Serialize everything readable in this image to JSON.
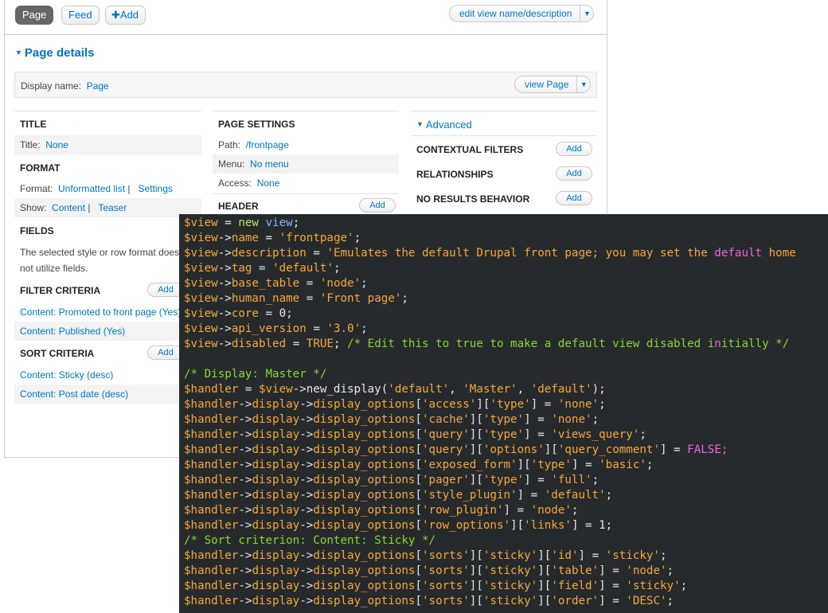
{
  "tabs": {
    "page": "Page",
    "feed": "Feed",
    "add": "Add"
  },
  "edit_view_btn": "edit view name/description",
  "page_details_title": "Page details",
  "display_name": {
    "label": "Display name:",
    "value": "Page",
    "view_btn": "view Page"
  },
  "col1": {
    "title_header": "TITLE",
    "title_label": "Title:",
    "title_value": "None",
    "format_header": "FORMAT",
    "format_label": "Format:",
    "format_value": "Unformatted list",
    "format_sep": "|",
    "format_settings": "Settings",
    "show_label": "Show:",
    "show_value": "Content",
    "show_sep": "|",
    "show_teaser": "Teaser",
    "fields_header": "FIELDS",
    "fields_note_1": "The selected style or row format does",
    "fields_note_2": "not utilize fields.",
    "filter_header": "FILTER CRITERIA",
    "filter_add": "Add",
    "filter_items": [
      "Content: Promoted to front page (Yes)",
      "Content: Published (Yes)"
    ],
    "sort_header": "SORT CRITERIA",
    "sort_add": "Add",
    "sort_items": [
      "Content: Sticky (desc)",
      "Content: Post date (desc)"
    ]
  },
  "col2": {
    "header": "PAGE SETTINGS",
    "path_label": "Path:",
    "path_value": "/frontpage",
    "menu_label": "Menu:",
    "menu_value": "No menu",
    "access_label": "Access:",
    "access_value": "None",
    "header_header": "HEADER",
    "header_add": "Add"
  },
  "col3": {
    "advanced": "Advanced",
    "contextual": "CONTEXTUAL FILTERS",
    "relationships": "RELATIONSHIPS",
    "no_results": "NO RESULTS BEHAVIOR",
    "add": "Add"
  },
  "colors": {
    "link": "#0074bd",
    "code_bg": "#272a2c",
    "code_var": "#f0a840",
    "code_comment": "#8ad33a",
    "code_const": "#e667d8"
  },
  "code_lines": [
    [
      [
        "v",
        "$view"
      ],
      [
        "p",
        " = "
      ],
      [
        "kw",
        "new"
      ],
      [
        "p",
        " "
      ],
      [
        "cls",
        "view"
      ],
      [
        "p",
        ";"
      ]
    ],
    [
      [
        "v",
        "$view"
      ],
      [
        "p",
        "->"
      ],
      [
        "v",
        "name"
      ],
      [
        "p",
        " = "
      ],
      [
        "s",
        "'frontpage'"
      ],
      [
        "p",
        ";"
      ]
    ],
    [
      [
        "v",
        "$view"
      ],
      [
        "p",
        "->"
      ],
      [
        "v",
        "description"
      ],
      [
        "p",
        " = "
      ],
      [
        "s",
        "'Emulates the default Drupal front page; you may set the "
      ],
      [
        "b",
        "default"
      ],
      [
        "s",
        " home"
      ]
    ],
    [
      [
        "v",
        "$view"
      ],
      [
        "p",
        "->"
      ],
      [
        "v",
        "tag"
      ],
      [
        "p",
        " = "
      ],
      [
        "s",
        "'default'"
      ],
      [
        "p",
        ";"
      ]
    ],
    [
      [
        "v",
        "$view"
      ],
      [
        "p",
        "->"
      ],
      [
        "v",
        "base_table"
      ],
      [
        "p",
        " = "
      ],
      [
        "s",
        "'node'"
      ],
      [
        "p",
        ";"
      ]
    ],
    [
      [
        "v",
        "$view"
      ],
      [
        "p",
        "->"
      ],
      [
        "v",
        "human_name"
      ],
      [
        "p",
        " = "
      ],
      [
        "s",
        "'Front page'"
      ],
      [
        "p",
        ";"
      ]
    ],
    [
      [
        "v",
        "$view"
      ],
      [
        "p",
        "->"
      ],
      [
        "v",
        "core"
      ],
      [
        "p",
        " = 0;"
      ]
    ],
    [
      [
        "v",
        "$view"
      ],
      [
        "p",
        "->"
      ],
      [
        "v",
        "api_version"
      ],
      [
        "p",
        " = "
      ],
      [
        "s",
        "'3.0'"
      ],
      [
        "p",
        ";"
      ]
    ],
    [
      [
        "v",
        "$view"
      ],
      [
        "p",
        "->"
      ],
      [
        "v",
        "disabled"
      ],
      [
        "p",
        " = "
      ],
      [
        "s",
        "TRUE"
      ],
      [
        "p",
        "; "
      ],
      [
        "c",
        "/* Edit this to true to make a default view disabled i"
      ],
      [
        "b",
        "n"
      ],
      [
        "c",
        "itially */"
      ]
    ],
    [],
    [
      [
        "c",
        "/* Display: Master */"
      ]
    ],
    [
      [
        "v",
        "$handler"
      ],
      [
        "p",
        " = "
      ],
      [
        "v",
        "$view"
      ],
      [
        "p",
        "->new_display("
      ],
      [
        "s",
        "'default'"
      ],
      [
        "p",
        ", "
      ],
      [
        "s",
        "'Master'"
      ],
      [
        "p",
        ", "
      ],
      [
        "s",
        "'default'"
      ],
      [
        "p",
        ");"
      ]
    ],
    [
      [
        "v",
        "$handler"
      ],
      [
        "p",
        "->"
      ],
      [
        "v",
        "display"
      ],
      [
        "p",
        "->"
      ],
      [
        "v",
        "display_options"
      ],
      [
        "p",
        "["
      ],
      [
        "s",
        "'access'"
      ],
      [
        "p",
        "]["
      ],
      [
        "s",
        "'type'"
      ],
      [
        "p",
        "] = "
      ],
      [
        "s",
        "'none'"
      ],
      [
        "p",
        ";"
      ]
    ],
    [
      [
        "v",
        "$handler"
      ],
      [
        "p",
        "->"
      ],
      [
        "v",
        "display"
      ],
      [
        "p",
        "->"
      ],
      [
        "v",
        "display_options"
      ],
      [
        "p",
        "["
      ],
      [
        "s",
        "'cache'"
      ],
      [
        "p",
        "]["
      ],
      [
        "s",
        "'type'"
      ],
      [
        "p",
        "] = "
      ],
      [
        "s",
        "'none'"
      ],
      [
        "p",
        ";"
      ]
    ],
    [
      [
        "v",
        "$handler"
      ],
      [
        "p",
        "->"
      ],
      [
        "v",
        "display"
      ],
      [
        "p",
        "->"
      ],
      [
        "v",
        "display_options"
      ],
      [
        "p",
        "["
      ],
      [
        "s",
        "'query'"
      ],
      [
        "p",
        "]["
      ],
      [
        "s",
        "'type'"
      ],
      [
        "p",
        "] = "
      ],
      [
        "s",
        "'views_query'"
      ],
      [
        "p",
        ";"
      ]
    ],
    [
      [
        "v",
        "$handler"
      ],
      [
        "p",
        "->"
      ],
      [
        "v",
        "display"
      ],
      [
        "p",
        "->"
      ],
      [
        "v",
        "display_options"
      ],
      [
        "p",
        "["
      ],
      [
        "s",
        "'query'"
      ],
      [
        "p",
        "]["
      ],
      [
        "s",
        "'options'"
      ],
      [
        "p",
        "]["
      ],
      [
        "s",
        "'query_comment'"
      ],
      [
        "p",
        "] = "
      ],
      [
        "b",
        "FALSE;"
      ]
    ],
    [
      [
        "v",
        "$handler"
      ],
      [
        "p",
        "->"
      ],
      [
        "v",
        "display"
      ],
      [
        "p",
        "->"
      ],
      [
        "v",
        "display_options"
      ],
      [
        "p",
        "["
      ],
      [
        "s",
        "'exposed_form'"
      ],
      [
        "p",
        "]["
      ],
      [
        "s",
        "'type'"
      ],
      [
        "p",
        "] = "
      ],
      [
        "s",
        "'basic'"
      ],
      [
        "p",
        ";"
      ]
    ],
    [
      [
        "v",
        "$handler"
      ],
      [
        "p",
        "->"
      ],
      [
        "v",
        "display"
      ],
      [
        "p",
        "->"
      ],
      [
        "v",
        "display_options"
      ],
      [
        "p",
        "["
      ],
      [
        "s",
        "'pager'"
      ],
      [
        "p",
        "]["
      ],
      [
        "s",
        "'type'"
      ],
      [
        "p",
        "] = "
      ],
      [
        "s",
        "'full'"
      ],
      [
        "p",
        ";"
      ]
    ],
    [
      [
        "v",
        "$handler"
      ],
      [
        "p",
        "->"
      ],
      [
        "v",
        "display"
      ],
      [
        "p",
        "->"
      ],
      [
        "v",
        "display_options"
      ],
      [
        "p",
        "["
      ],
      [
        "s",
        "'style_plugin'"
      ],
      [
        "p",
        "] = "
      ],
      [
        "s",
        "'default'"
      ],
      [
        "p",
        ";"
      ]
    ],
    [
      [
        "v",
        "$handler"
      ],
      [
        "p",
        "->"
      ],
      [
        "v",
        "display"
      ],
      [
        "p",
        "->"
      ],
      [
        "v",
        "display_options"
      ],
      [
        "p",
        "["
      ],
      [
        "s",
        "'row_plugin'"
      ],
      [
        "p",
        "] = "
      ],
      [
        "s",
        "'node'"
      ],
      [
        "p",
        ";"
      ]
    ],
    [
      [
        "v",
        "$handler"
      ],
      [
        "p",
        "->"
      ],
      [
        "v",
        "display"
      ],
      [
        "p",
        "->"
      ],
      [
        "v",
        "display_options"
      ],
      [
        "p",
        "["
      ],
      [
        "s",
        "'row_options'"
      ],
      [
        "p",
        "]["
      ],
      [
        "s",
        "'links'"
      ],
      [
        "p",
        "] = 1;"
      ]
    ],
    [
      [
        "c",
        "/* Sort criterion: Content: Sticky */"
      ]
    ],
    [
      [
        "v",
        "$handler"
      ],
      [
        "p",
        "->"
      ],
      [
        "v",
        "display"
      ],
      [
        "p",
        "->"
      ],
      [
        "v",
        "display_options"
      ],
      [
        "p",
        "["
      ],
      [
        "s",
        "'sorts'"
      ],
      [
        "p",
        "]["
      ],
      [
        "s",
        "'sticky'"
      ],
      [
        "p",
        "]["
      ],
      [
        "s",
        "'id'"
      ],
      [
        "p",
        "] = "
      ],
      [
        "s",
        "'sticky'"
      ],
      [
        "p",
        ";"
      ]
    ],
    [
      [
        "v",
        "$handler"
      ],
      [
        "p",
        "->"
      ],
      [
        "v",
        "display"
      ],
      [
        "p",
        "->"
      ],
      [
        "v",
        "display_options"
      ],
      [
        "p",
        "["
      ],
      [
        "s",
        "'sorts'"
      ],
      [
        "p",
        "]["
      ],
      [
        "s",
        "'sticky'"
      ],
      [
        "p",
        "]["
      ],
      [
        "s",
        "'table'"
      ],
      [
        "p",
        "] = "
      ],
      [
        "s",
        "'node'"
      ],
      [
        "p",
        ";"
      ]
    ],
    [
      [
        "v",
        "$handler"
      ],
      [
        "p",
        "->"
      ],
      [
        "v",
        "display"
      ],
      [
        "p",
        "->"
      ],
      [
        "v",
        "display_options"
      ],
      [
        "p",
        "["
      ],
      [
        "s",
        "'sorts'"
      ],
      [
        "p",
        "]["
      ],
      [
        "s",
        "'sticky'"
      ],
      [
        "p",
        "]["
      ],
      [
        "s",
        "'field'"
      ],
      [
        "p",
        "] = "
      ],
      [
        "s",
        "'sticky'"
      ],
      [
        "p",
        ";"
      ]
    ],
    [
      [
        "v",
        "$handler"
      ],
      [
        "p",
        "->"
      ],
      [
        "v",
        "display"
      ],
      [
        "p",
        "->"
      ],
      [
        "v",
        "display_options"
      ],
      [
        "p",
        "["
      ],
      [
        "s",
        "'sorts'"
      ],
      [
        "p",
        "]["
      ],
      [
        "s",
        "'sticky'"
      ],
      [
        "p",
        "]["
      ],
      [
        "s",
        "'order'"
      ],
      [
        "p",
        "] = "
      ],
      [
        "s",
        "'DESC'"
      ],
      [
        "p",
        ";"
      ]
    ]
  ]
}
